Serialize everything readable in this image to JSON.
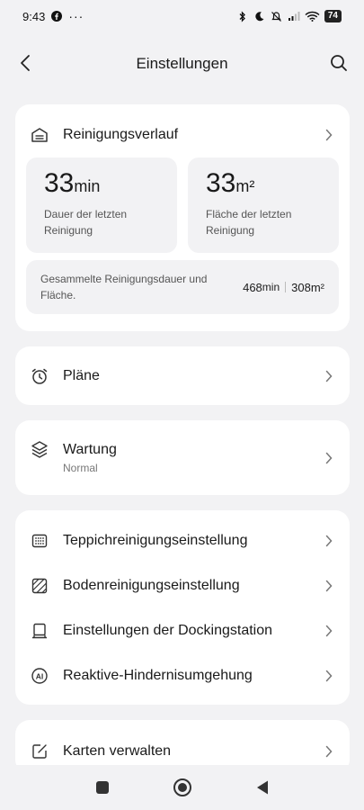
{
  "status": {
    "time": "9:43",
    "battery": "74"
  },
  "header": {
    "title": "Einstellungen"
  },
  "history": {
    "label": "Reinigungsverlauf",
    "last_duration_value": "33",
    "last_duration_unit": "min",
    "last_duration_desc": "Dauer der letzten Reinigung",
    "last_area_value": "33",
    "last_area_unit": "m²",
    "last_area_desc": "Fläche der letzten Reinigung",
    "total_desc": "Gesammelte Reinigungsdauer und Fläche.",
    "total_duration_value": "468",
    "total_duration_unit": "min",
    "total_area": "308m²"
  },
  "plans": {
    "label": "Pläne"
  },
  "maintenance": {
    "label": "Wartung",
    "status": "Normal"
  },
  "settings_group": [
    {
      "label": "Teppichreinigungseinstellung",
      "icon": "carpet-icon"
    },
    {
      "label": "Bodenreinigungseinstellung",
      "icon": "floor-icon"
    },
    {
      "label": "Einstellungen der Dockingstation",
      "icon": "dock-icon"
    },
    {
      "label": "Reaktive-Hindernisumgehung",
      "icon": "ai-icon"
    }
  ],
  "maps": {
    "label": "Karten verwalten"
  },
  "colors": {
    "background": "#f2f2f4",
    "card": "#ffffff",
    "text": "#1a1a1a",
    "secondary": "#555555"
  }
}
